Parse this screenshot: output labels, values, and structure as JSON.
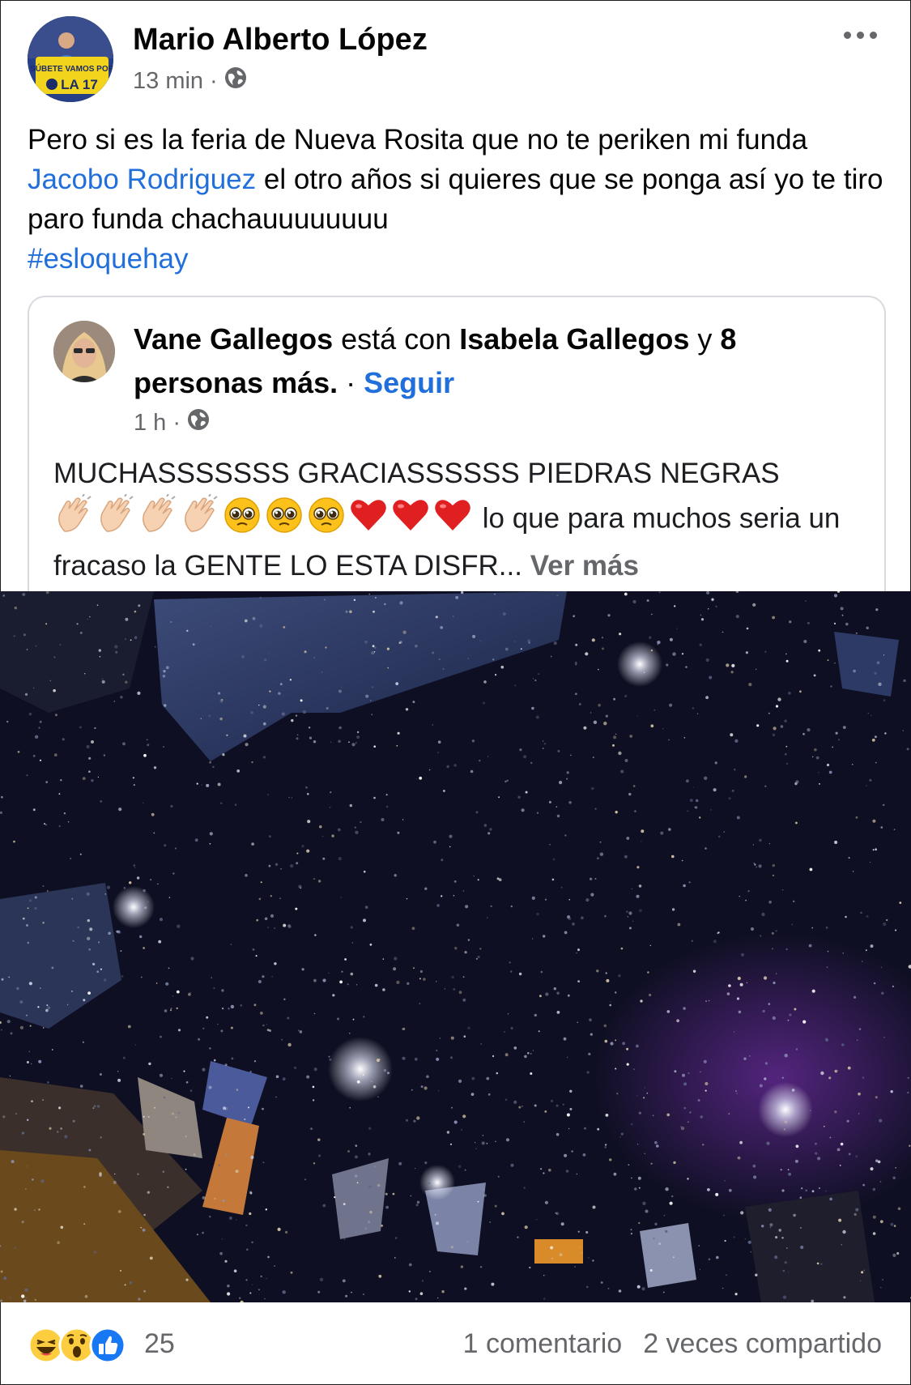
{
  "post": {
    "author": "Mario Alberto López",
    "time": "13 min",
    "separator": "·",
    "avatar_text_1": "SÚBETE VAMOS POR",
    "avatar_text_2": "LA 17",
    "text_part1": "Pero si es la feria de Nueva Rosita que no te periken mi funda ",
    "mention": "Jacobo Rodriguez",
    "text_part2": " el otro años si quieres que se ponga así yo te tiro paro funda chachauuuuuuuu",
    "hashtag": "#esloquehay"
  },
  "shared": {
    "author": "Vane Gallegos",
    "with_word": " está con ",
    "tagged": "Isabela Gallegos",
    "and_word": " y ",
    "others": "8 personas más.",
    "dot": " · ",
    "follow_label": "Seguir",
    "time": "1 h",
    "separator": "·",
    "text_part1": "MUCHASSSSSSS GRACIASSSSSS PIEDRAS NEGRAS",
    "text_part2": " lo que para muchos seria un fracaso la GENTE LO ESTA DISFR... ",
    "see_more": "Ver más"
  },
  "footer": {
    "reaction_count": "25",
    "comments": "1 comentario",
    "shares": "2 veces compartido"
  },
  "colors": {
    "link": "#216fdb",
    "secondary_text": "#65676b",
    "card_border": "#d8dadf"
  },
  "icons": [
    "globe-icon",
    "more-options-icon",
    "clap-emoji-icon",
    "pleading-face-emoji-icon",
    "heart-emoji-icon",
    "haha-reaction-icon",
    "wow-reaction-icon",
    "like-reaction-icon"
  ]
}
